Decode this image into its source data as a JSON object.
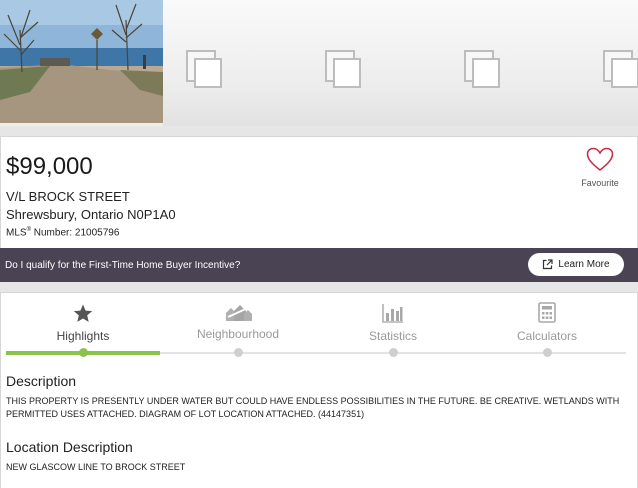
{
  "listing": {
    "price": "$99,000",
    "street": "V/L BROCK STREET",
    "city": "Shrewsbury, Ontario N0P1A0",
    "mls_prefix": "MLS",
    "mls_sup": "®",
    "mls_label": " Number: ",
    "mls_number": "21005796",
    "favourite_label": "Favourite"
  },
  "incentive": {
    "question": "Do I qualify for the First-Time Home Buyer Incentive?",
    "learn_more": "Learn More"
  },
  "tabs": [
    {
      "label": "Highlights",
      "icon": "star-icon",
      "active": true
    },
    {
      "label": "Neighbourhood",
      "icon": "neighbourhood-icon",
      "active": false
    },
    {
      "label": "Statistics",
      "icon": "bar-chart-icon",
      "active": false
    },
    {
      "label": "Calculators",
      "icon": "calculator-icon",
      "active": false
    }
  ],
  "description": {
    "heading": "Description",
    "text": "THIS PROPERTY IS PRESENTLY UNDER WATER BUT COULD HAVE ENDLESS POSSIBILITIES IN THE FUTURE. BE CREATIVE. WETLANDS WITH PERMITTED USES ATTACHED. DIAGRAM OF LOT LOCATION ATTACHED. (44147351)"
  },
  "location": {
    "heading": "Location Description",
    "text": "NEW GLASCOW LINE TO BROCK STREET"
  },
  "colors": {
    "accent_green": "#8bc34a",
    "incentive_bg": "#4a4354",
    "favourite_heart": "#c4304a"
  }
}
